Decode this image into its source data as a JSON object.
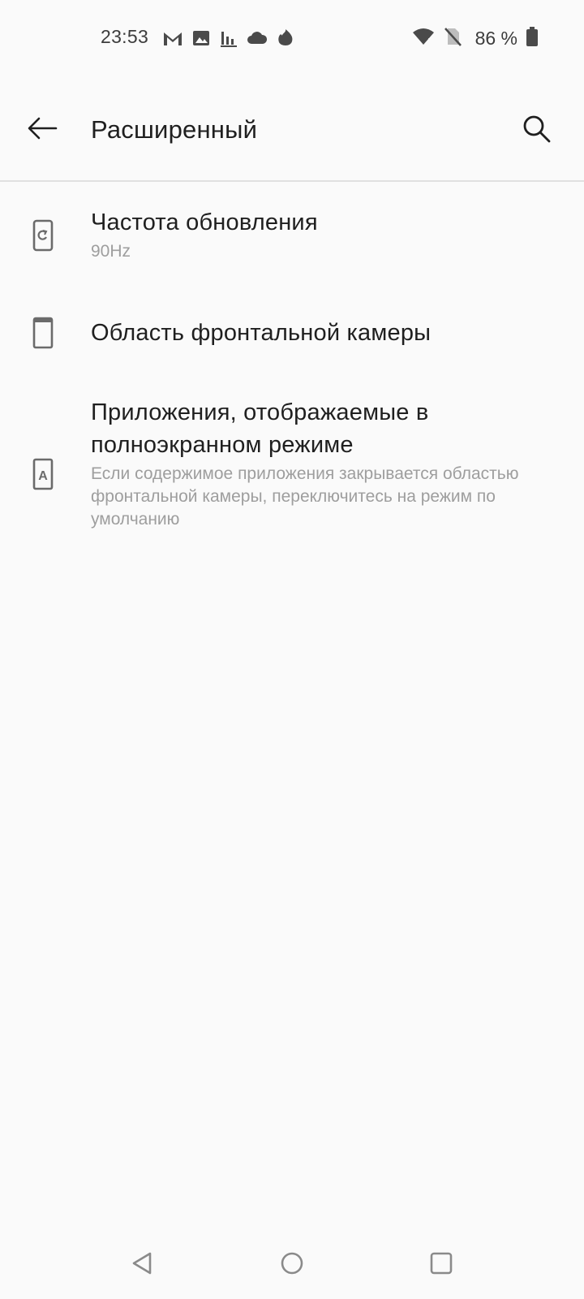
{
  "status_bar": {
    "time": "23:53",
    "notification_icons": [
      "gmail-icon",
      "image-icon",
      "chart-icon",
      "cloud-icon",
      "tinder-flame-icon"
    ],
    "wifi_icon": "wifi-icon",
    "sim_icon": "no-sim-icon",
    "battery_percent": "86 %",
    "battery_icon": "battery-icon"
  },
  "app_bar": {
    "title": "Расширенный",
    "back_icon": "arrow-back-icon",
    "search_icon": "search-icon"
  },
  "settings": [
    {
      "icon": "refresh-rate-icon",
      "title": "Частота обновления",
      "summary": "90Hz"
    },
    {
      "icon": "front-camera-area-icon",
      "title": "Область фронтальной камеры",
      "summary": ""
    },
    {
      "icon": "fullscreen-apps-icon",
      "title": "Приложения, отображаемые в полноэкранном режиме",
      "summary": "Если содержимое приложения закрывается областью фронтальной камеры, переключитесь на режим по умолчанию"
    }
  ],
  "nav_bar": {
    "back_icon": "nav-back-triangle-icon",
    "home_icon": "nav-home-circle-icon",
    "recents_icon": "nav-recents-square-icon"
  },
  "colors": {
    "background": "#fafafa",
    "text_primary": "#1f1f1f",
    "text_secondary": "#9e9e9e",
    "icon": "#5f6368",
    "divider": "#e0e0e0"
  }
}
